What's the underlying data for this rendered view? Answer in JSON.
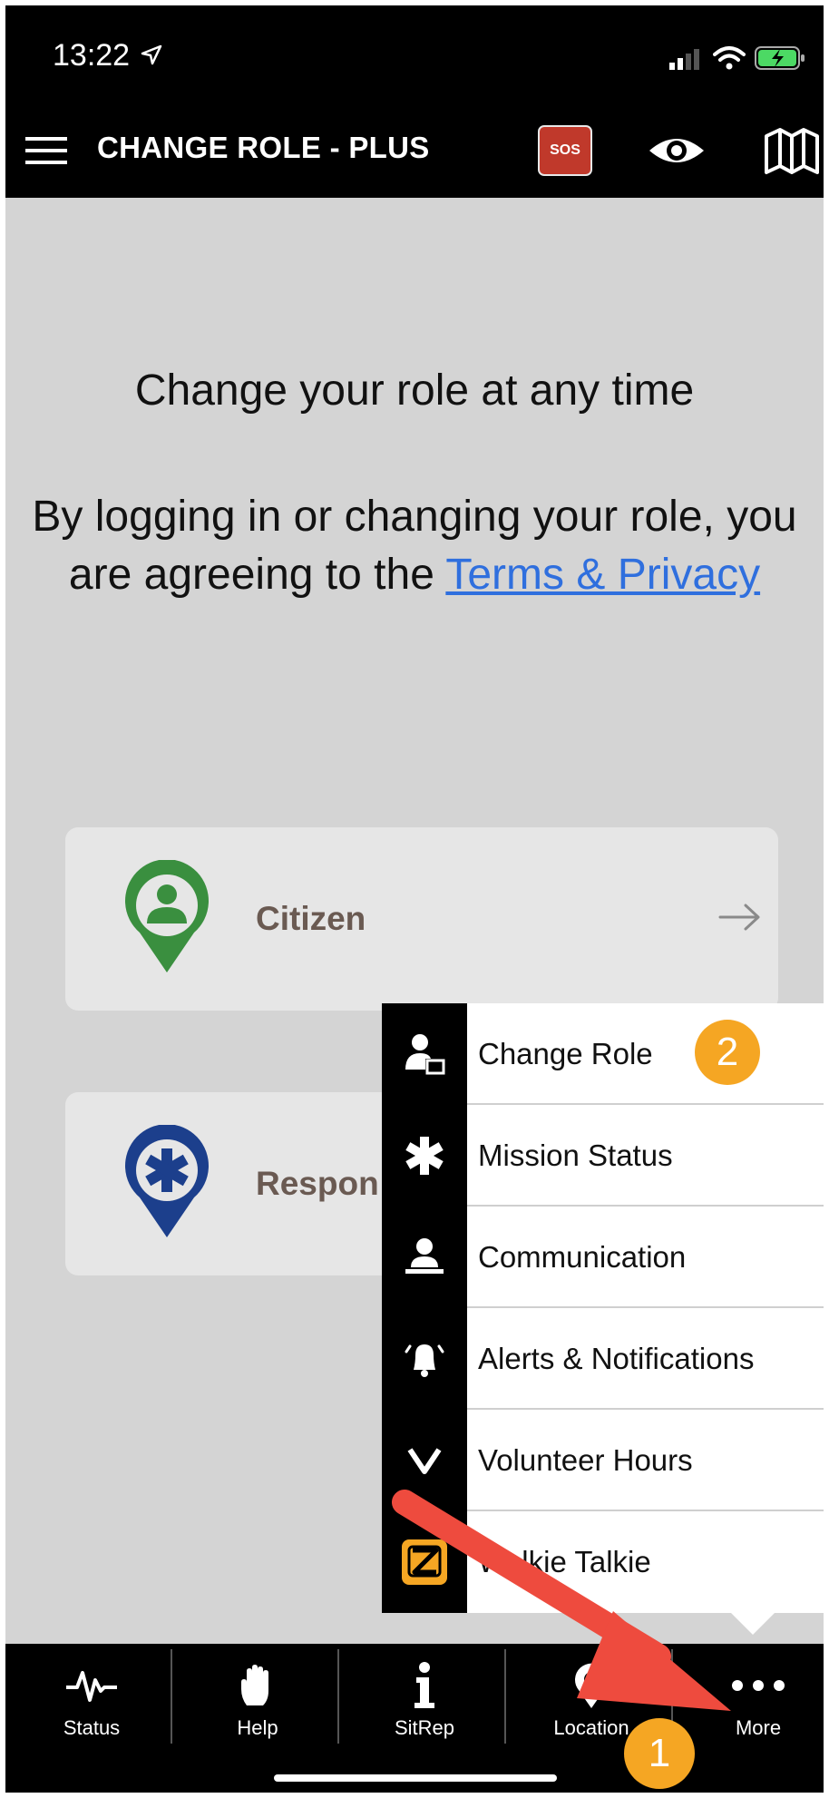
{
  "status_bar": {
    "time": "13:22"
  },
  "header": {
    "title": "CHANGE ROLE - PLUS",
    "sos_label": "SOS"
  },
  "content": {
    "headline": "Change your role at any time",
    "agreement_text": "By logging in or changing your role, you are agreeing to the ",
    "terms_link": "Terms & Privacy",
    "roles": [
      {
        "label": "Citizen",
        "color": "#3a8f3f"
      },
      {
        "label": "Respon",
        "color": "#1c3f8c"
      }
    ]
  },
  "more_menu": {
    "items": [
      {
        "label": "Change Role",
        "icon": "change-role-icon"
      },
      {
        "label": "Mission Status",
        "icon": "asterisk-icon"
      },
      {
        "label": "Communication",
        "icon": "communication-icon"
      },
      {
        "label": "Alerts & Notifications",
        "icon": "bell-icon"
      },
      {
        "label": "Volunteer Hours",
        "icon": "chevron-down-icon"
      },
      {
        "label": "Walkie Talkie",
        "icon": "zello-icon"
      }
    ]
  },
  "bottom_nav": {
    "items": [
      {
        "label": "Status",
        "icon": "pulse-icon"
      },
      {
        "label": "Help",
        "icon": "hand-icon"
      },
      {
        "label": "SitRep",
        "icon": "info-icon"
      },
      {
        "label": "Location",
        "icon": "location-pin-icon"
      },
      {
        "label": "More",
        "icon": "more-dots-icon"
      }
    ]
  },
  "annotations": {
    "badge_1": "1",
    "badge_2": "2"
  },
  "colors": {
    "accent_badge": "#f5a623",
    "arrow": "#ee4b3e",
    "link": "#2f6fde",
    "sos": "#c0392b"
  }
}
